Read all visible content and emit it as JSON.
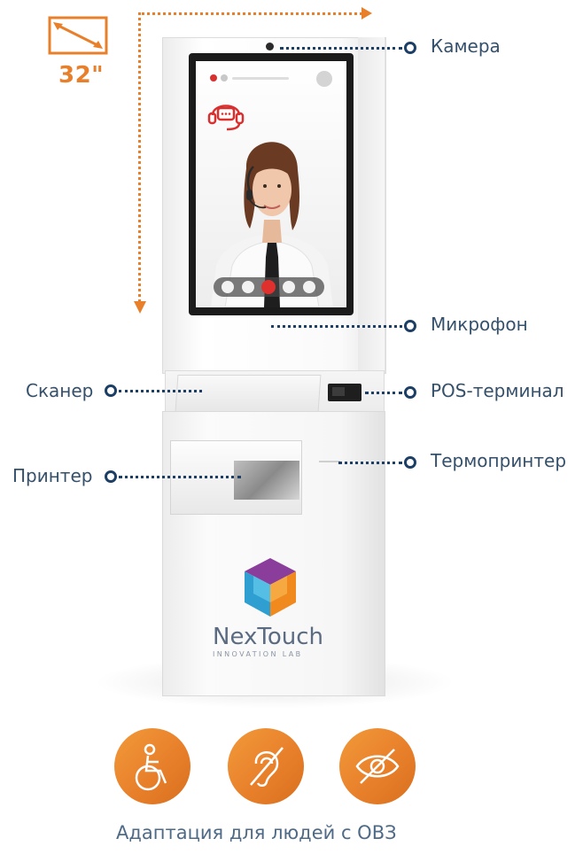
{
  "screen_size": {
    "label": "32\""
  },
  "callouts": {
    "camera": "Камера",
    "microphone": "Микрофон",
    "scanner": "Сканер",
    "pos": "POS-терминал",
    "printer": "Принтер",
    "thermoprinter": "Термопринтер"
  },
  "brand": {
    "name": "NexTouch",
    "subtitle": "INNOVATION LAB"
  },
  "accessibility": {
    "caption": "Адаптация для людей с ОВЗ",
    "icons": [
      "wheelchair-icon",
      "hearing-impaired-icon",
      "vision-impaired-icon"
    ]
  },
  "colors": {
    "accent": "#e8802b",
    "callout": "#1d3f66",
    "text": "#35506b"
  }
}
